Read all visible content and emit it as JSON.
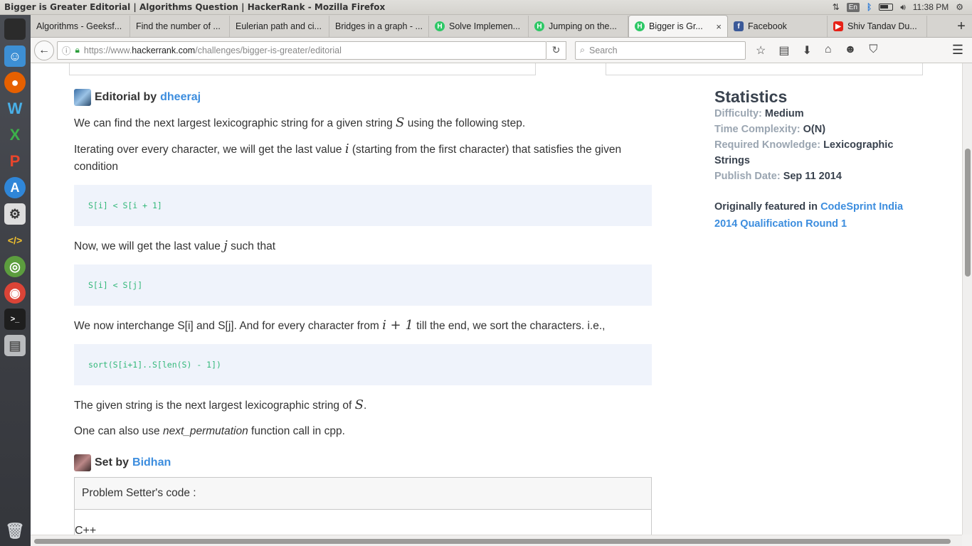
{
  "window": {
    "title": "Bigger is Greater Editorial | Algorithms Question | HackerRank - Mozilla Firefox"
  },
  "tray": {
    "keyboard": "En",
    "time": "11:38 PM"
  },
  "tabs": [
    {
      "label": "Algorithms - Geeksf...",
      "favicon": ""
    },
    {
      "label": "Find the number of ...",
      "favicon": ""
    },
    {
      "label": "Eulerian path and ci...",
      "favicon": ""
    },
    {
      "label": "Bridges in a graph - ...",
      "favicon": ""
    },
    {
      "label": "Solve Implemen...",
      "favicon": "H"
    },
    {
      "label": "Jumping on the...",
      "favicon": "H"
    },
    {
      "label": "Bigger is Gr...",
      "favicon": "H",
      "active": true
    },
    {
      "label": "Facebook",
      "favicon": "f"
    },
    {
      "label": "Shiv Tandav Du...",
      "favicon": "▶"
    }
  ],
  "navbar": {
    "url_prefix": "https://www.",
    "url_domain": "hackerrank.com",
    "url_path": "/challenges/bigger-is-greater/editorial",
    "search_placeholder": "Search"
  },
  "editorial": {
    "prefix": "Editorial by",
    "author": "dheeraj",
    "p1_before": "We can find the next largest lexicographic string for a given string",
    "p1_math": "S",
    "p1_after": "using the following step.",
    "p2_before": "Iterating over every character, we will get the last value",
    "p2_math": "i",
    "p2_after": "(starting from the first character) that satisfies the given condition",
    "code1": "S[i] < S[i + 1]",
    "p3_before": "Now, we will get the last value",
    "p3_math": "j",
    "p3_after": "such that",
    "code2": "S[i] < S[j]",
    "p4_before": "We now interchange S[i] and S[j]. And for every character from",
    "p4_math": "i + 1",
    "p4_after": "till the end, we sort the characters. i.e.,",
    "code3": "sort(S[i+1]..S[len(S) - 1])",
    "p5_before": "The given string is the next largest lexicographic string of",
    "p5_math": "S",
    "p5_after": ".",
    "p6_before": "One can also use",
    "p6_em": "next_permutation",
    "p6_after": "function call in cpp."
  },
  "setter": {
    "prefix": "Set by",
    "name": "Bidhan",
    "box_header": "Problem Setter's code :",
    "language": "C++"
  },
  "statistics": {
    "title": "Statistics",
    "difficulty_label": "Difficulty:",
    "difficulty": "Medium",
    "complexity_label": "Time Complexity:",
    "complexity": "O(N)",
    "knowledge_label": "Required Knowledge:",
    "knowledge": "Lexicographic Strings",
    "date_label": "Publish Date:",
    "date": "Sep 11 2014",
    "featured_prefix": "Originally featured in",
    "featured_link": "CodeSprint India 2014 Qualification Round 1"
  }
}
